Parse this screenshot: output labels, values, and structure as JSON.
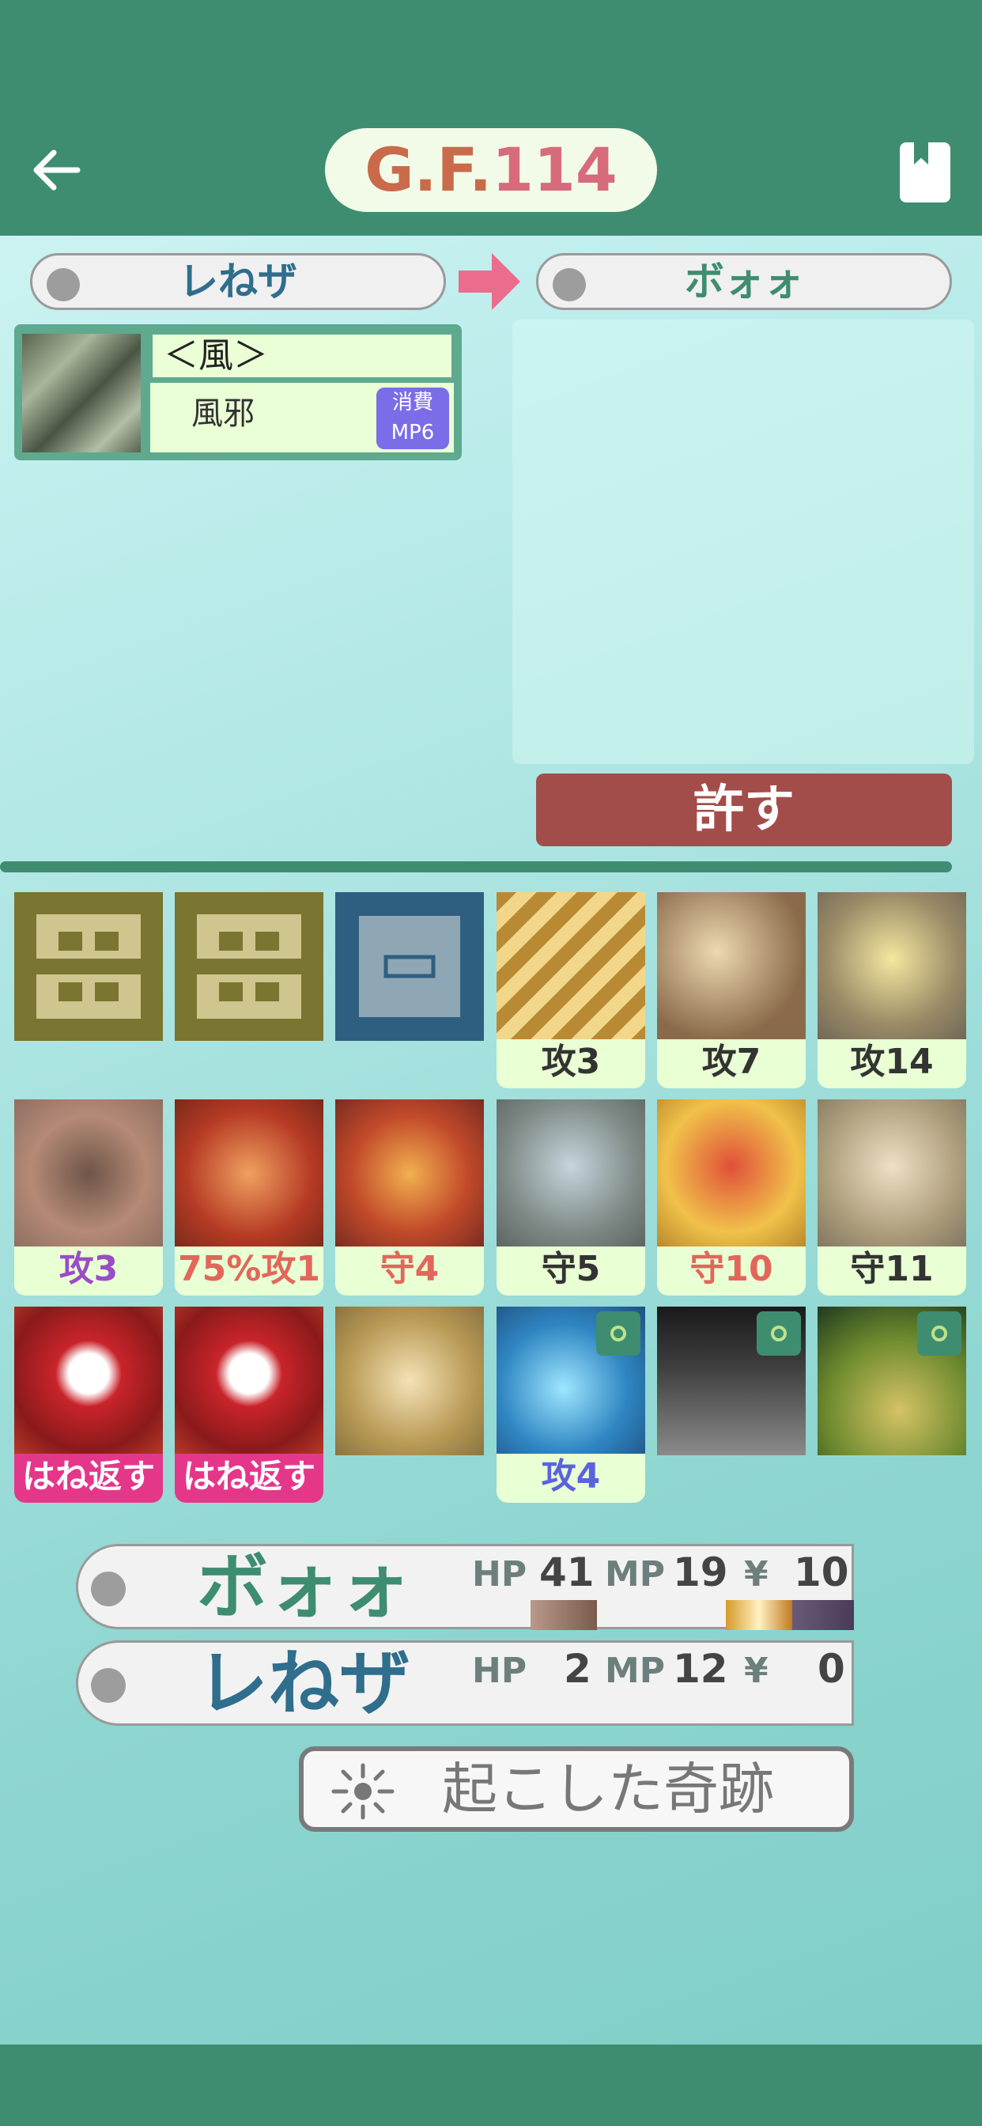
{
  "header": {
    "title_prefix": "G.F.",
    "title_number": "114"
  },
  "duel": {
    "caster": "レねザ",
    "target": "ボォォ"
  },
  "spell": {
    "category": "＜風＞",
    "name": "風邪",
    "cost_label": "消費",
    "cost_value": "MP6"
  },
  "forgive_button": "許す",
  "cards": [
    {
      "label": ""
    },
    {
      "label": ""
    },
    {
      "label": ""
    },
    {
      "label": "攻3"
    },
    {
      "label": "攻7"
    },
    {
      "label": "攻14"
    },
    {
      "label": "攻3"
    },
    {
      "label": "75%攻1"
    },
    {
      "label": "守4"
    },
    {
      "label": "守5"
    },
    {
      "label": "守10"
    },
    {
      "label": "守11"
    },
    {
      "label": "はね返す"
    },
    {
      "label": "はね返す"
    },
    {
      "label": ""
    },
    {
      "label": "攻4"
    },
    {
      "label": ""
    },
    {
      "label": ""
    }
  ],
  "players": [
    {
      "name": "ボォォ",
      "hp_label": "HP",
      "hp": "41",
      "mp_label": "MP",
      "mp": "19",
      "money_label": "¥",
      "money": "10"
    },
    {
      "name": "レねザ",
      "hp_label": "HP",
      "hp": "2",
      "mp_label": "MP",
      "mp": "12",
      "money_label": "¥",
      "money": "0"
    }
  ],
  "miracle_button": "起こした奇跡",
  "colors": {
    "accent": "#3e8d70",
    "forgive": "#a34d4a",
    "attack_purple": "#9a4cc7",
    "attack_red": "#e2665a",
    "attack_blue": "#5a62e0"
  }
}
